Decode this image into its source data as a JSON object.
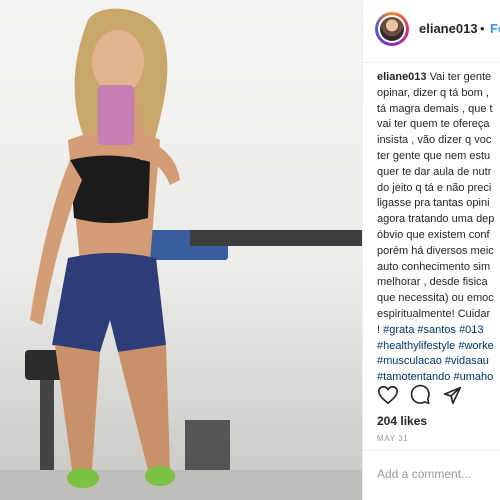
{
  "post": {
    "username": "eliane013",
    "separator": "•",
    "follow_label": "Fol",
    "caption_user": "eliane013",
    "caption_lines": [
      " Vai ter gente",
      "opinar, dizer q tá bom ,",
      "tá magra demais , que t",
      "vai ter quem te ofereça",
      "insista , vão dizer q voc",
      "ter gente que nem estu",
      "quer te dar aula de nutr",
      "do jeito q tá e não preci",
      "ligasse pra tantas opini",
      "agora tratando uma dep",
      "óbvio que existem conf",
      "porém há diversos meic",
      "auto conhecimento sim",
      "melhorar , desde fisica",
      "que necessita) ou emoc",
      "espiritualmente! Cuidar"
    ],
    "hashtag_lines": [
      [
        "! ",
        "#grata",
        " ",
        "#santos",
        " ",
        "#013",
        " "
      ],
      [
        "#healthylifestyle",
        " ",
        "#worke"
      ],
      [
        "#musculacao",
        " ",
        "#vidasau"
      ],
      [
        "#tamotentando",
        " ",
        "#umaho"
      ]
    ],
    "likes": "204 likes",
    "date": "MAY 31",
    "comment_placeholder": "Add a comment...",
    "icons": [
      "heart-icon",
      "comment-icon",
      "share-icon"
    ],
    "colors": {
      "link": "#3897f0",
      "hashtag": "#003569",
      "text": "#262626",
      "muted": "#999999"
    }
  }
}
